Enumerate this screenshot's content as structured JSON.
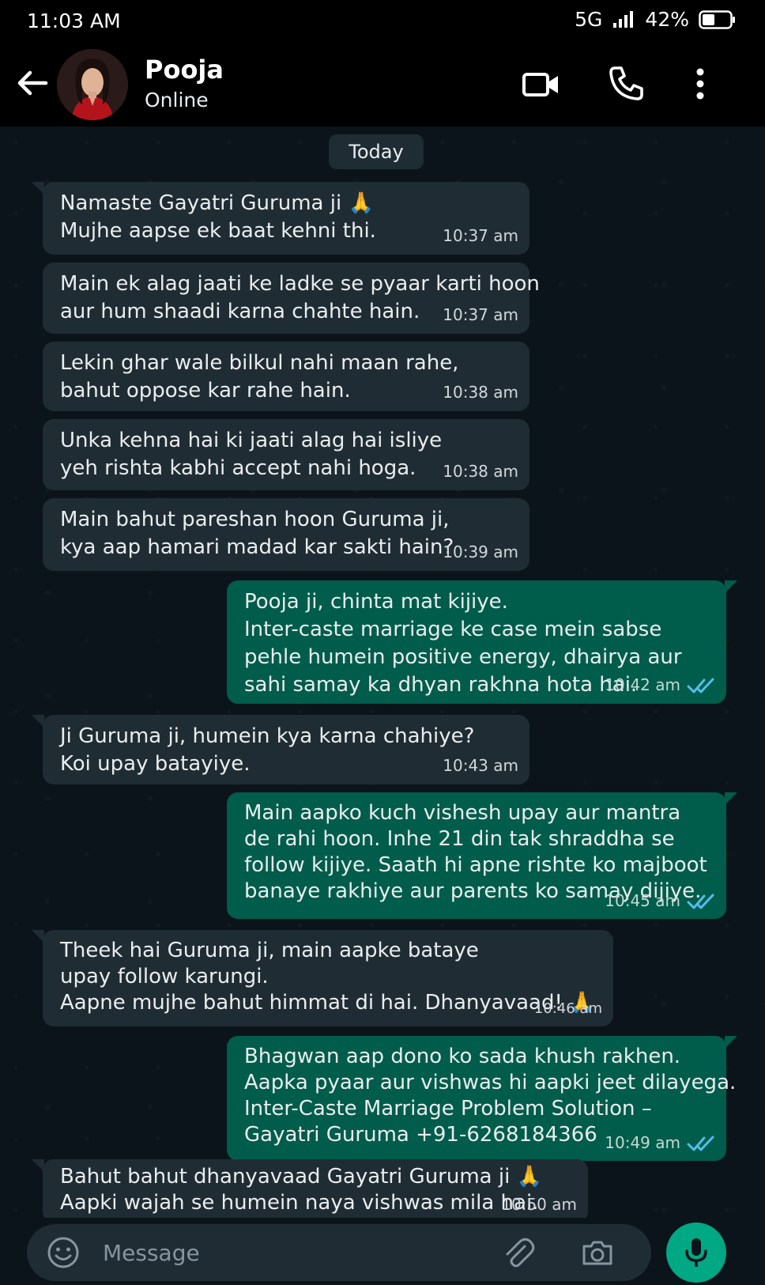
{
  "status_bar": {
    "time": "11:03 AM",
    "network": "5G",
    "battery": "42%"
  },
  "contact": {
    "name": "Pooja",
    "status": "Online"
  },
  "chat": {
    "date_label": "Today",
    "messages": [
      {
        "direction": "in",
        "lines": [
          "Namaste Gayatri Guruma ji 🙏",
          "Mujhe aapse ek baat kehni thi."
        ],
        "time": "10:37 am"
      },
      {
        "direction": "in",
        "lines": [
          "Main ek alag jaati ke ladke se pyaar karti hoon",
          "aur hum shaadi karna chahte hain."
        ],
        "time": "10:37 am"
      },
      {
        "direction": "in",
        "lines": [
          "Lekin ghar wale bilkul nahi maan rahe,",
          "bahut oppose kar rahe hain."
        ],
        "time": "10:38 am"
      },
      {
        "direction": "in",
        "lines": [
          "Unka kehna hai ki jaati alag hai isliye",
          "yeh rishta kabhi accept nahi hoga."
        ],
        "time": "10:38 am"
      },
      {
        "direction": "in",
        "lines": [
          "Main bahut pareshan hoon Guruma ji,",
          "kya aap hamari madad kar sakti hain?"
        ],
        "time": "10:39 am"
      },
      {
        "direction": "out",
        "lines": [
          "Pooja ji, chinta mat kijiye.",
          "Inter-caste marriage ke case mein sabse",
          "pehle humein positive energy, dhairya aur",
          "sahi samay ka dhyan rakhna hota hai."
        ],
        "time": "10:42 am",
        "read": true
      },
      {
        "direction": "in",
        "lines": [
          "Ji Guruma ji, humein kya karna chahiye?",
          "Koi upay batayiye."
        ],
        "time": "10:43 am"
      },
      {
        "direction": "out",
        "lines": [
          "Main aapko kuch vishesh upay aur mantra",
          "de rahi hoon. Inhe 21 din tak shraddha se",
          "follow kijiye. Saath hi apne rishte ko majboot",
          "banaye rakhiye aur parents ko samay dijiye."
        ],
        "time": "10:45 am",
        "read": true
      },
      {
        "direction": "in",
        "lines": [
          "Theek hai Guruma ji, main aapke bataye",
          "upay follow karungi.",
          "Aapne mujhe bahut himmat di hai. Dhanyavaad! 🙏"
        ],
        "time": "10:46 am"
      },
      {
        "direction": "out",
        "lines": [
          "Bhagwan aap dono ko sada khush rakhen.",
          "Aapka pyaar aur vishwas hi aapki jeet dilayega.",
          "Inter-Caste Marriage Problem Solution –",
          "Gayatri Guruma +91-6268184366"
        ],
        "time": "10:49 am",
        "read": true
      },
      {
        "direction": "in",
        "lines": [
          "Bahut bahut dhanyavaad Gayatri Guruma ji 🙏",
          "Aapki wajah se humein naya vishwas mila hai."
        ],
        "time": "10:50 am"
      }
    ]
  },
  "input": {
    "placeholder": "Message"
  },
  "colors": {
    "incoming_bubble": "#202c33",
    "outgoing_bubble": "#005c4b",
    "background": "#0b141a",
    "accent": "#00a884",
    "read_ticks": "#53bdeb"
  },
  "icons": [
    "back-arrow-icon",
    "video-call-icon",
    "phone-icon",
    "more-vert-icon",
    "emoji-icon",
    "attach-icon",
    "camera-icon",
    "mic-icon",
    "double-check-icon"
  ]
}
